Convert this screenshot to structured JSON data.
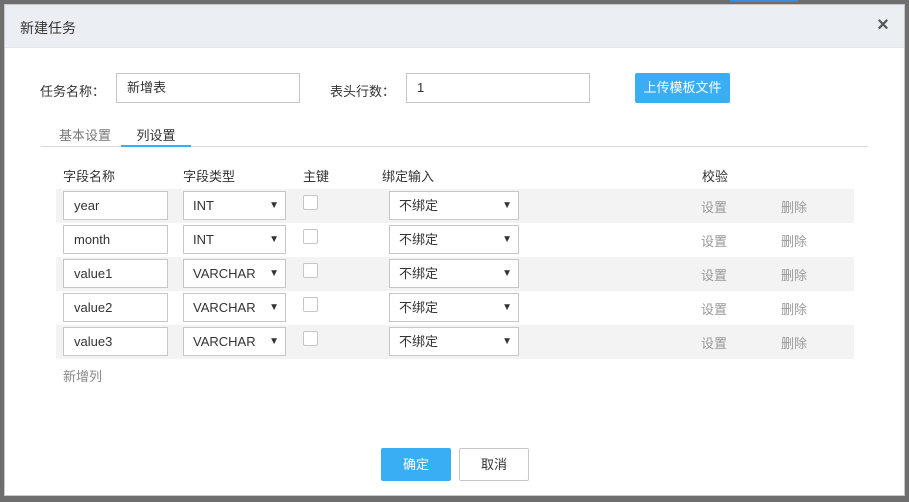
{
  "dialog": {
    "title": "新建任务",
    "close_icon": "×"
  },
  "form": {
    "task_name_label": "任务名称：",
    "task_name_value": "新增表",
    "header_rows_label": "表头行数：",
    "header_rows_value": "1",
    "upload_label": "上传模板文件"
  },
  "tabs": [
    {
      "label": "基本设置",
      "active": false
    },
    {
      "label": "列设置",
      "active": true
    }
  ],
  "table": {
    "headers": [
      "字段名称",
      "字段类型",
      "主键",
      "绑定输入",
      "校验"
    ],
    "rows": [
      {
        "name": "year",
        "type": "INT",
        "primary_key": false,
        "bind": "不绑定",
        "set": "设置",
        "delete": "删除"
      },
      {
        "name": "month",
        "type": "INT",
        "primary_key": false,
        "bind": "不绑定",
        "set": "设置",
        "delete": "删除"
      },
      {
        "name": "value1",
        "type": "VARCHAR",
        "primary_key": false,
        "bind": "不绑定",
        "set": "设置",
        "delete": "删除"
      },
      {
        "name": "value2",
        "type": "VARCHAR",
        "primary_key": false,
        "bind": "不绑定",
        "set": "设置",
        "delete": "删除"
      },
      {
        "name": "value3",
        "type": "VARCHAR",
        "primary_key": false,
        "bind": "不绑定",
        "set": "设置",
        "delete": "删除"
      }
    ],
    "add_column_label": "新增列"
  },
  "footer": {
    "confirm_label": "确定",
    "cancel_label": "取消"
  },
  "icons": {
    "caret": "▼"
  },
  "colors": {
    "accent": "#39aef5",
    "header_bg": "#ebeef2",
    "stripe": "#f3f3f3"
  }
}
